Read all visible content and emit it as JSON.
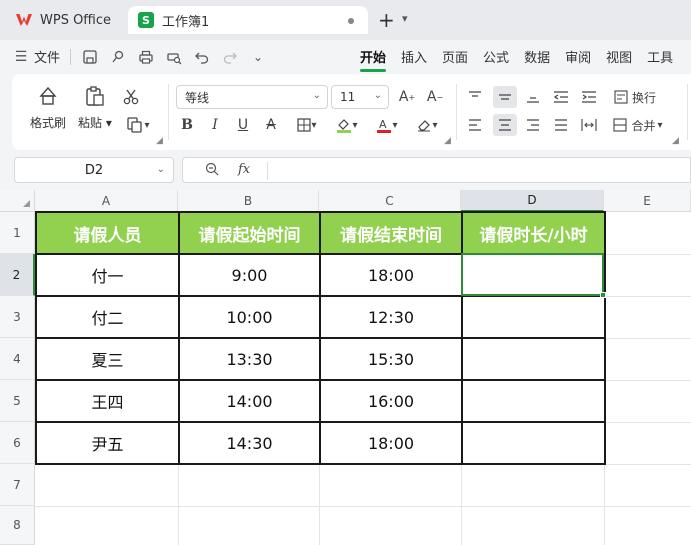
{
  "titlebar": {
    "app_tab": "WPS Office",
    "doc_tab": "工作簿1",
    "doc_icon_letter": "S"
  },
  "menubar": {
    "file_label": "文件",
    "tabs": [
      "开始",
      "插入",
      "页面",
      "公式",
      "数据",
      "审阅",
      "视图",
      "工具"
    ],
    "active_tab": "开始"
  },
  "ribbon": {
    "format_painter": "格式刷",
    "paste": "粘贴",
    "font_name": "等线",
    "font_size": "11",
    "wrap_text": "换行",
    "merge": "合并"
  },
  "formula_bar": {
    "name_box": "D2",
    "fx_label": "fx",
    "content": ""
  },
  "sheet": {
    "columns": [
      "A",
      "B",
      "C",
      "D",
      "E"
    ],
    "rows": [
      "1",
      "2",
      "3",
      "4",
      "5",
      "6",
      "7",
      "8"
    ],
    "selected_cell": "D2",
    "header": [
      "请假人员",
      "请假起始时间",
      "请假结束时间",
      "请假时长/小时"
    ],
    "data": [
      [
        "付一",
        "9:00",
        "18:00",
        ""
      ],
      [
        "付二",
        "10:00",
        "12:30",
        ""
      ],
      [
        "夏三",
        "13:30",
        "15:30",
        ""
      ],
      [
        "王四",
        "14:00",
        "16:00",
        ""
      ],
      [
        "尹五",
        "14:30",
        "18:00",
        ""
      ]
    ],
    "header_fill": "#92d050",
    "selection_color": "#2e8b3a"
  }
}
